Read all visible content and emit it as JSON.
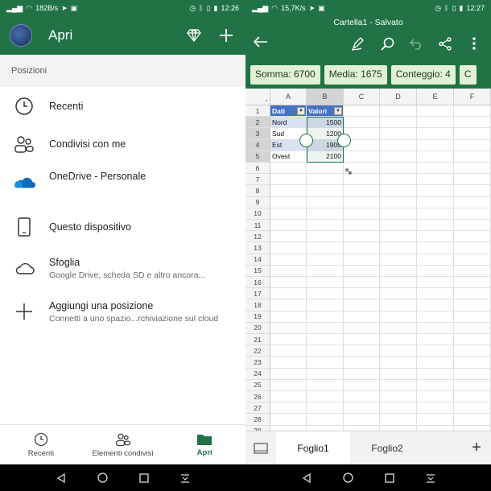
{
  "left": {
    "status": {
      "speed": "182B/s",
      "time": "12:26"
    },
    "header": {
      "title": "Apri"
    },
    "section_label": "Posizioni",
    "locations": [
      {
        "label": "Recenti",
        "sub": "",
        "icon": "clock-icon"
      },
      {
        "label": "Condivisi con me",
        "sub": "",
        "icon": "people-icon"
      },
      {
        "label": "OneDrive - Personale",
        "sub": "",
        "icon": "onedrive-icon"
      },
      {
        "label": "Questo dispositivo",
        "sub": "",
        "icon": "phone-icon"
      },
      {
        "label": "Sfoglia",
        "sub": "Google Drive, scheda SD e altro ancora...",
        "icon": "cloud-icon"
      },
      {
        "label": "Aggiungi una posizione",
        "sub": "Connetti a uno spazio...rchiviazione sul cloud",
        "icon": "plus-icon"
      }
    ],
    "bottom_nav": [
      {
        "label": "Recenti",
        "icon": "clock-icon",
        "active": false
      },
      {
        "label": "Elementi condivisi",
        "icon": "people-icon",
        "active": false
      },
      {
        "label": "Apri",
        "icon": "folder-icon",
        "active": true
      }
    ]
  },
  "right": {
    "status": {
      "speed": "15,7K/s",
      "time": "12:27"
    },
    "doc_title": "Cartella1 - Salvato",
    "stats": [
      "Somma: 6700",
      "Media: 1675",
      "Conteggio: 4",
      "C"
    ],
    "columns": [
      "A",
      "B",
      "C",
      "D",
      "E",
      "F"
    ],
    "rows": [
      "1",
      "2",
      "3",
      "4",
      "5",
      "6",
      "7",
      "8",
      "9",
      "10",
      "11",
      "12",
      "13",
      "14",
      "15",
      "16",
      "17",
      "18",
      "19",
      "20",
      "21",
      "22",
      "23",
      "24",
      "25",
      "26",
      "27",
      "28",
      "29"
    ],
    "table": {
      "headers": [
        "Dati",
        "Valori"
      ],
      "data": [
        [
          "Nord",
          "1500"
        ],
        [
          "Sud",
          "1200"
        ],
        [
          "Est",
          "1900"
        ],
        [
          "Ovest",
          "2100"
        ]
      ]
    },
    "sheets": [
      {
        "label": "Foglio1",
        "active": true
      },
      {
        "label": "Foglio2",
        "active": false
      }
    ],
    "add_sheet": "+"
  },
  "colors": {
    "accent": "#217346",
    "table_header": "#4472c4",
    "table_band": "#d9e1f2"
  }
}
